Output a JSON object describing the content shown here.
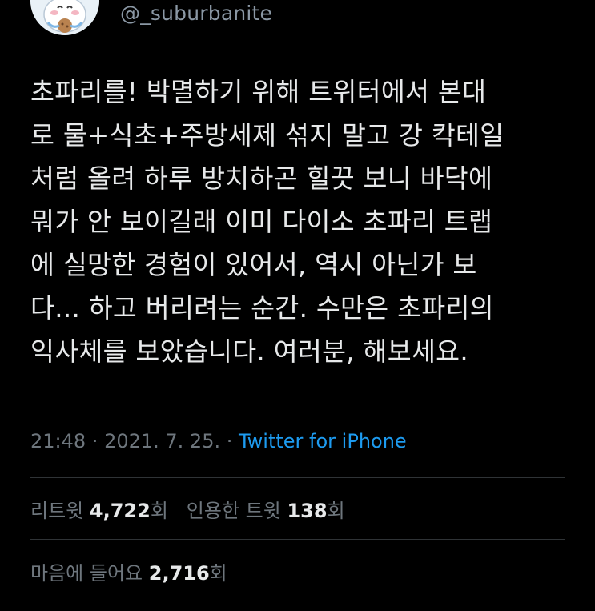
{
  "tweet": {
    "handle": "@_suburbanite",
    "text": "초파리를! 박멸하기 위해 트위터에서 본대\n로 물+식초+주방세제 섞지 말고 강 칵테일\n처럼 올려 하루 방치하곤 힐끗 보니 바닥에\n뭐가 안 보이길래 이미 다이소 초파리 트랩\n에 실망한 경험이 있어서, 역시 아닌가 보\n다... 하고 버리려는 순간. 수만은 초파리의\n익사체를 보았습니다. 여러분, 해보세요.",
    "time": "21:48",
    "separator": " · ",
    "date": "2021. 7. 25.",
    "source": "Twitter for iPhone"
  },
  "stats": {
    "retweets": {
      "label": "리트윗",
      "count": "4,722",
      "suffix": "회"
    },
    "quotes": {
      "label": "인용한 트윗",
      "count": "138",
      "suffix": "회"
    },
    "likes": {
      "label": "마음에 들어요",
      "count": "2,716",
      "suffix": "회"
    }
  },
  "colors": {
    "background": "#000000",
    "text": "#e7e9ea",
    "muted": "#6e767d",
    "link": "#1d9bf0",
    "divider": "#2f3336"
  }
}
